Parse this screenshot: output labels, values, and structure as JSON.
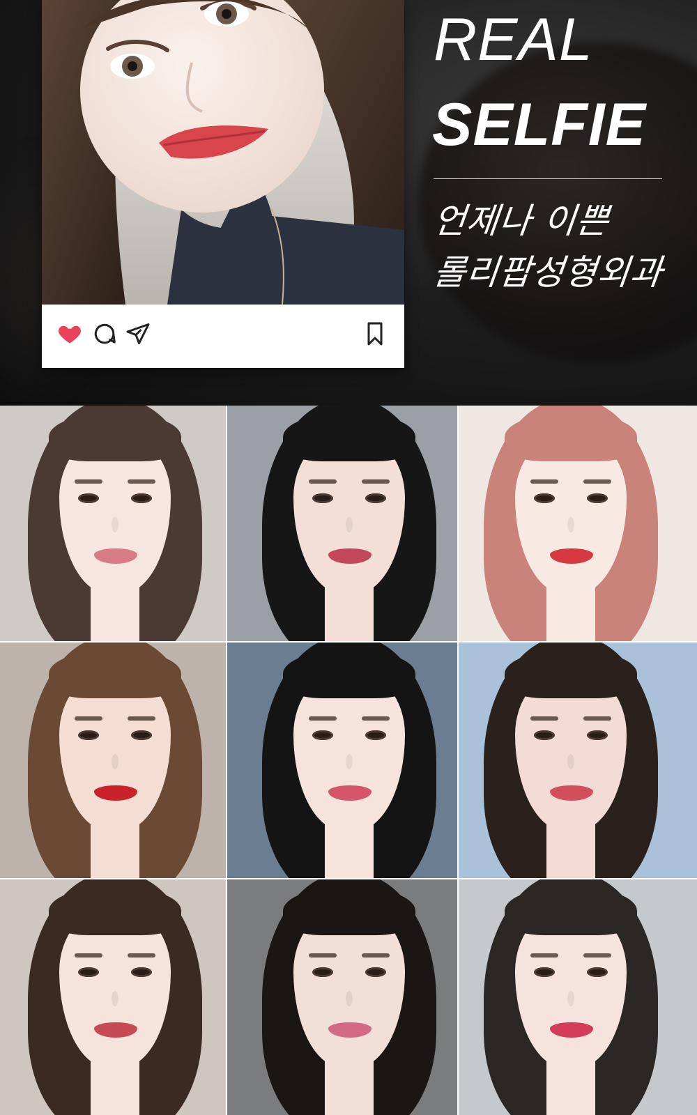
{
  "hero": {
    "title_line1": "REAL",
    "title_line2": "SELFIE",
    "subtitle_line1": "언제나 이쁜",
    "subtitle_line2": "롤리팝성형외과"
  },
  "post": {
    "actions": [
      "heart-icon",
      "comment-icon",
      "share-icon",
      "bookmark-icon"
    ],
    "heart_color": "#e8435a"
  },
  "gallery": {
    "rows": 3,
    "columns": 3,
    "photos": [
      {
        "hair": "#4a3a33",
        "lips": "#d77b86"
      },
      {
        "hair": "#161616",
        "lips": "#c2475a"
      },
      {
        "hair": "#c9837a",
        "lips": "#d6393f"
      },
      {
        "hair": "#6a4a35",
        "lips": "#c9222b"
      },
      {
        "hair": "#141414",
        "lips": "#d4566a"
      },
      {
        "hair": "#2a211c",
        "lips": "#d2505c"
      },
      {
        "hair": "#3a2a22",
        "lips": "#c74a55"
      },
      {
        "hair": "#1a1614",
        "lips": "#d26a86"
      },
      {
        "hair": "#2b2724",
        "lips": "#d23c58"
      }
    ]
  },
  "colors": {
    "background": "#111111",
    "text": "#ffffff",
    "card": "#ffffff"
  }
}
